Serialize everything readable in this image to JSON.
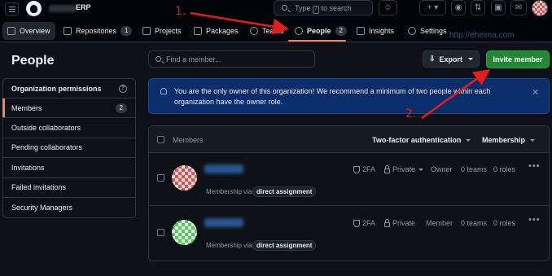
{
  "header": {
    "org_name": "ERP",
    "search_prefix": "Type",
    "search_key": "/",
    "search_suffix": "to search",
    "icons": [
      "hamburger-icon",
      "github-logo",
      "search-icon",
      "copilot-icon",
      "plus-icon",
      "issues-icon",
      "pull-requests-icon",
      "inbox-icon"
    ]
  },
  "nav": {
    "tabs": [
      {
        "label": "Overview",
        "icon": "overview-icon"
      },
      {
        "label": "Repositories",
        "count": "1",
        "icon": "repo-icon"
      },
      {
        "label": "Projects",
        "icon": "table-icon"
      },
      {
        "label": "Packages",
        "icon": "package-icon"
      },
      {
        "label": "Teams",
        "icon": "people-icon"
      },
      {
        "label": "People",
        "count": "2",
        "icon": "person-icon"
      },
      {
        "label": "Insights",
        "icon": "graph-icon"
      },
      {
        "label": "Settings",
        "icon": "gear-icon"
      }
    ],
    "active_tab": "People"
  },
  "watermark": "http://eheima.com",
  "page": {
    "title": "People",
    "search_placeholder": "Find a member...",
    "export_label": "Export",
    "invite_label": "Invite member"
  },
  "sidebar": {
    "heading": "Organization permissions",
    "items": [
      {
        "label": "Members",
        "count": "2"
      },
      {
        "label": "Outside collaborators"
      },
      {
        "label": "Pending collaborators"
      },
      {
        "label": "Invitations"
      },
      {
        "label": "Failed invitations"
      },
      {
        "label": "Security Managers"
      }
    ]
  },
  "banner": {
    "text": "You are the only owner of this organization! We recommend a minimum of two people within each organization have the owner role.",
    "close": "✕"
  },
  "members_table": {
    "header": {
      "members": "Members",
      "two_factor": "Two-factor authentication",
      "membership": "Membership"
    },
    "rows": [
      {
        "twofa": "2FA",
        "visibility": "Private",
        "role": "Owner",
        "teams": "0 teams",
        "roles": "0 roles",
        "via_label": "Membership via:",
        "via_badge": "direct assignment"
      },
      {
        "twofa": "2FA",
        "visibility": "Private",
        "role": "Member",
        "teams": "0 teams",
        "roles": "0 roles",
        "via_label": "Membership via:",
        "via_badge": "direct assignment"
      }
    ]
  },
  "annotations": {
    "label_1": "1.",
    "label_2": "2.",
    "color": "#e11d1d"
  }
}
